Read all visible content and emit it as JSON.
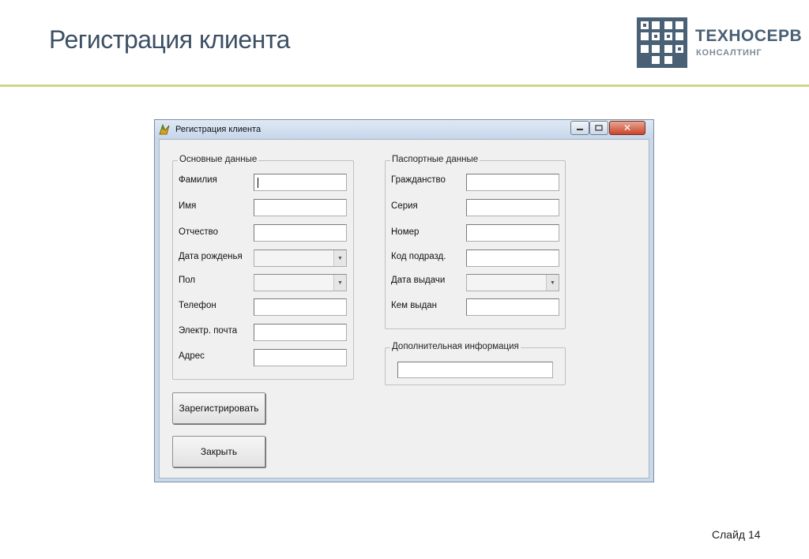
{
  "slide": {
    "title": "Регистрация клиента",
    "number_label": "Слайд 14"
  },
  "logo": {
    "line1": "ТЕХНОСЕРВ",
    "line2": "КОНСАЛТИНГ",
    "colors": {
      "mark": "#4a6075",
      "text": "#4a6075",
      "subtext": "#7d8a96"
    }
  },
  "window": {
    "title": "Регистрация клиента",
    "icon": "app-icon",
    "controls": {
      "minimize": "minimize-icon",
      "maximize": "maximize-icon",
      "close": "close-icon"
    },
    "close_glyph": "✕"
  },
  "basic": {
    "legend": "Основные данные",
    "fields": {
      "last_name": "Фамилия",
      "first_name": "Имя",
      "patronymic": "Отчество",
      "birth_date": "Дата рожденья",
      "gender": "Пол",
      "phone": "Телефон",
      "email": "Электр. почта",
      "address": "Адрес"
    }
  },
  "passport": {
    "legend": "Паспортные данные",
    "fields": {
      "citizenship": "Гражданство",
      "series": "Серия",
      "number": "Номер",
      "division_code": "Код подразд.",
      "issue_date": "Дата выдачи",
      "issued_by": "Кем выдан"
    }
  },
  "extra": {
    "legend": "Дополнительная информация"
  },
  "buttons": {
    "register": "Зарегистрировать",
    "close": "Закрыть"
  },
  "colors": {
    "title_text": "#3d4f63",
    "rule": "#cfd48c"
  }
}
